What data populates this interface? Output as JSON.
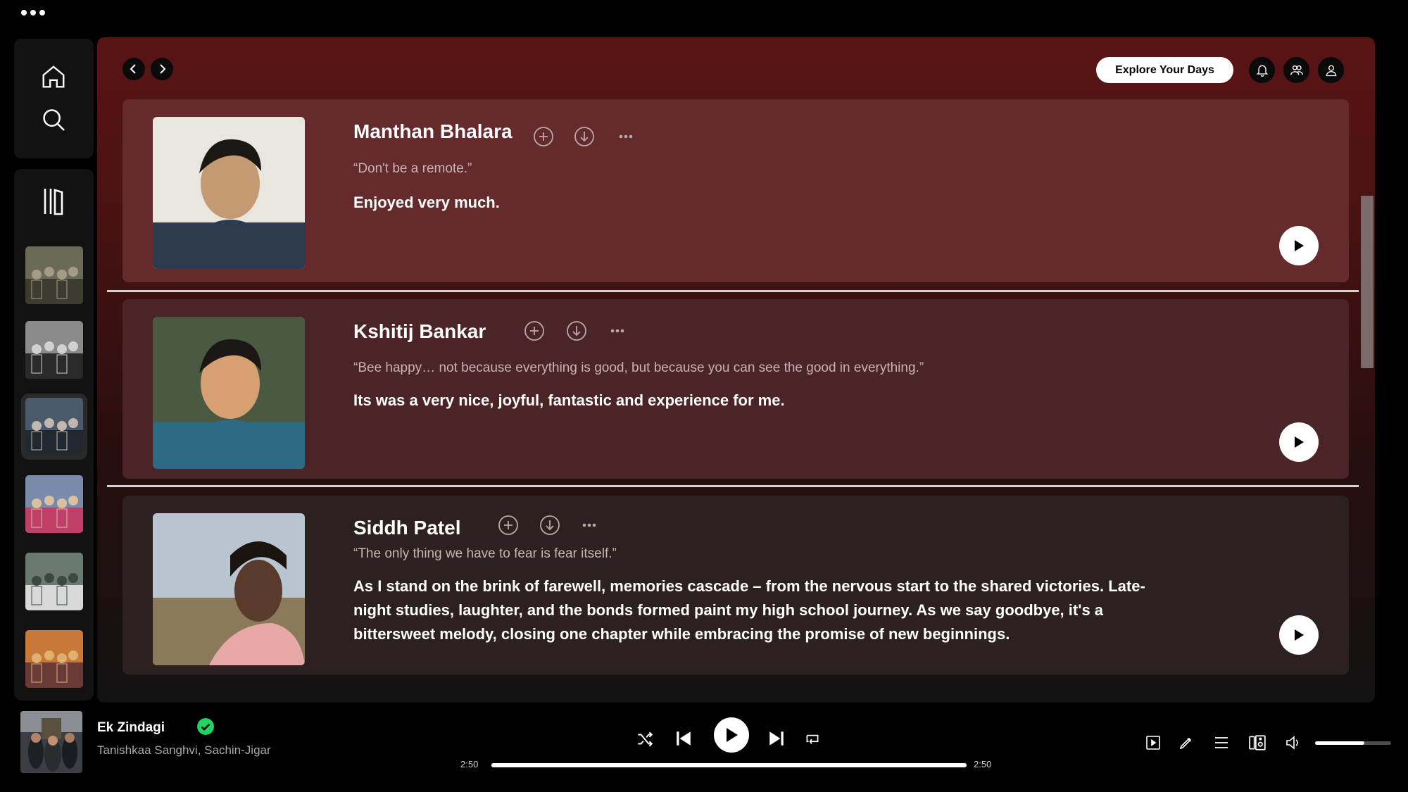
{
  "window": {
    "menu_icon": "more-dots-icon"
  },
  "sidebar": {
    "nav": [
      {
        "name": "home",
        "icon": "home-icon"
      },
      {
        "name": "search",
        "icon": "search-icon"
      }
    ],
    "library_icon": "library-icon",
    "playlists": [
      {
        "name": "playlist-1",
        "palette": [
          "#6b6a58",
          "#3d3c30",
          "#a39c82"
        ]
      },
      {
        "name": "playlist-2",
        "palette": [
          "#8a8a8a",
          "#2a2a2a",
          "#d0d0d0"
        ]
      },
      {
        "name": "playlist-3",
        "palette": [
          "#4a5a6a",
          "#222830",
          "#c0b8b0"
        ]
      },
      {
        "name": "playlist-4",
        "palette": [
          "#7a8aaa",
          "#c0406a",
          "#d8c0a0"
        ]
      },
      {
        "name": "playlist-5",
        "palette": [
          "#6a7a70",
          "#d8d8d8",
          "#3a4a40"
        ]
      },
      {
        "name": "playlist-6",
        "palette": [
          "#c87838",
          "#6a3a38",
          "#e0b070"
        ]
      }
    ]
  },
  "header": {
    "explore_label": "Explore Your Days",
    "icons": [
      "bell-icon",
      "friends-icon",
      "profile-icon"
    ]
  },
  "cards": [
    {
      "name": "Manthan Bhalara",
      "quote": "“Don't be a remote.”",
      "message": "Enjoyed very much.",
      "photo_palette": [
        "#e9e6df",
        "#2e3a50",
        "#c59a72"
      ]
    },
    {
      "name": "Kshitij Bankar",
      "quote": "“Bee happy… not because everything is good, but because you can see the good in everything.”",
      "message": "Its was a very nice, joyful, fantastic and experience for me.",
      "photo_palette": [
        "#4a5a42",
        "#2c6a86",
        "#d6a070"
      ]
    },
    {
      "name": "Siddh Patel",
      "quote": "“The only thing we have to fear is fear itself.”",
      "message": "As I stand on the brink of farewell, memories cascade – from the nervous start to the shared victories. Late-night studies, laughter, and the bonds formed paint my high school journey. As we say goodbye, it's a bittersweet melody, closing one chapter while embracing the promise of new beginnings.",
      "photo_palette": [
        "#b8c4d0",
        "#8a7a5a",
        "#5a3a2a"
      ]
    }
  ],
  "player": {
    "title": "Ek Zindagi",
    "artist": "Tanishkaa Sanghvi, Sachin-Jigar",
    "liked": true,
    "time_elapsed": "2:50",
    "time_total": "2:50",
    "progress_fraction": 1.0,
    "volume_fraction": 0.65,
    "accent_green": "#1ed760",
    "controls": [
      "shuffle-icon",
      "previous-icon",
      "play-icon",
      "next-icon",
      "repeat-icon"
    ],
    "right_controls": [
      "now-playing-view-icon",
      "lyrics-icon",
      "queue-icon",
      "connect-device-icon",
      "volume-icon"
    ]
  }
}
